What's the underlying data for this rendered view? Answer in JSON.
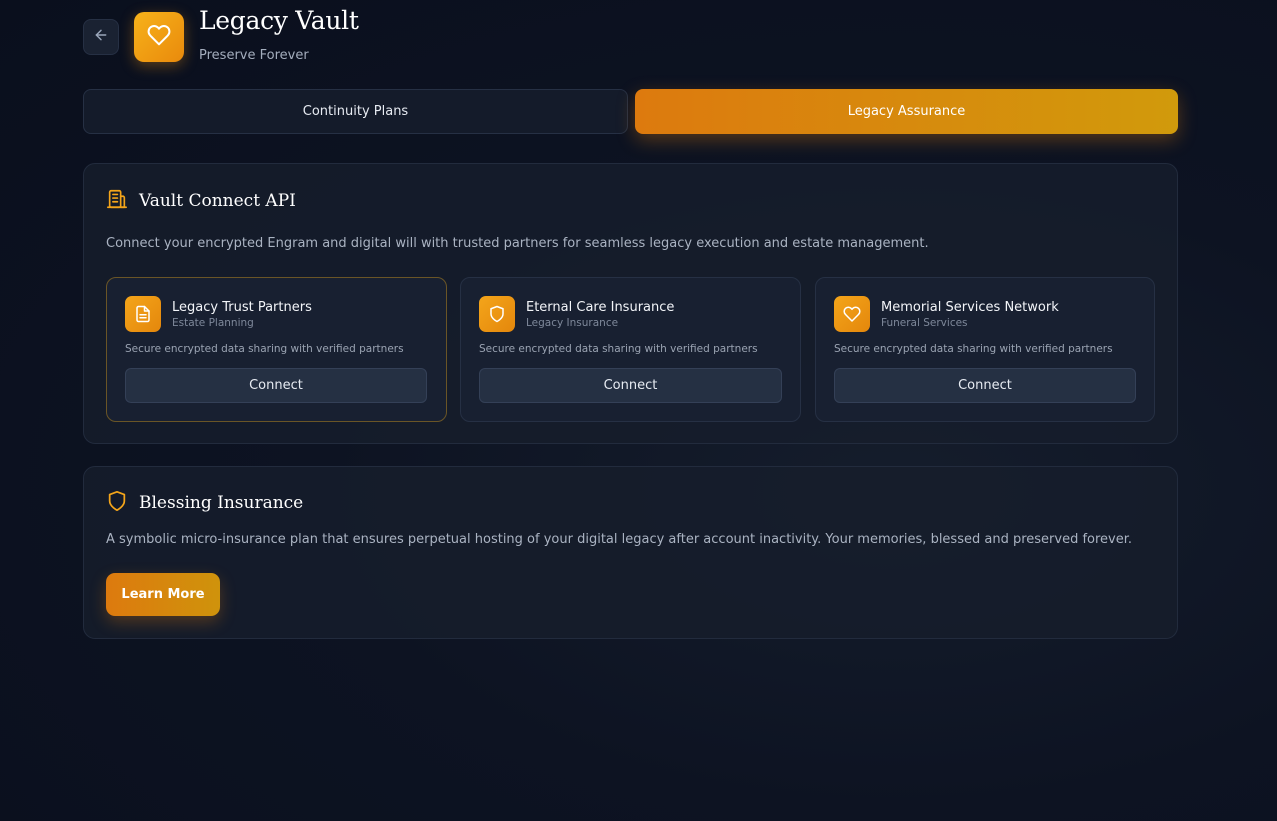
{
  "header": {
    "title": "Legacy Vault",
    "subtitle": "Preserve Forever",
    "back_icon": "arrow-left-icon",
    "logo_icon": "heart-icon"
  },
  "tabs": [
    {
      "label": "Continuity Plans",
      "active": false
    },
    {
      "label": "Legacy Assurance",
      "active": true
    }
  ],
  "vault_connect": {
    "title": "Vault Connect API",
    "icon": "building-icon",
    "description": "Connect your encrypted Engram and digital will with trusted partners for seamless legacy execution and estate management.",
    "partners": [
      {
        "name": "Legacy Trust Partners",
        "category": "Estate Planning",
        "description": "Secure encrypted data sharing with verified partners",
        "button": "Connect",
        "icon": "document-icon"
      },
      {
        "name": "Eternal Care Insurance",
        "category": "Legacy Insurance",
        "description": "Secure encrypted data sharing with verified partners",
        "button": "Connect",
        "icon": "shield-icon"
      },
      {
        "name": "Memorial Services Network",
        "category": "Funeral Services",
        "description": "Secure encrypted data sharing with verified partners",
        "button": "Connect",
        "icon": "heart-icon"
      }
    ]
  },
  "blessing": {
    "title": "Blessing Insurance",
    "icon": "shield-icon",
    "description": "A symbolic micro-insurance plan that ensures perpetual hosting of your digital legacy after account inactivity. Your memories, blessed and preserved forever.",
    "button": "Learn More"
  },
  "colors": {
    "accent": "#dd7a0e",
    "accent_gold": "#f4a51a",
    "background": "#0d1322"
  }
}
